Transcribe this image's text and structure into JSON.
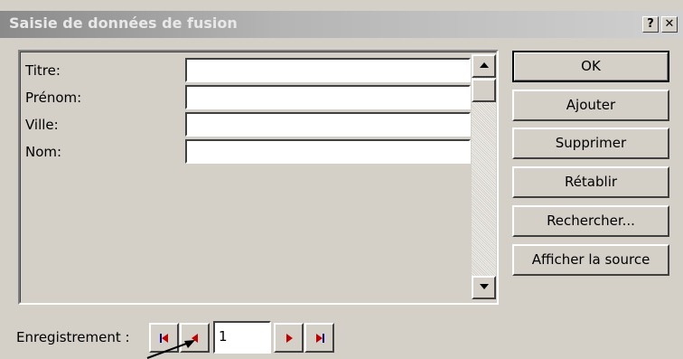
{
  "window": {
    "title": "Saisie de données de fusion",
    "help_label": "?",
    "close_label": "✕"
  },
  "fields": [
    {
      "label": "Titre:",
      "value": ""
    },
    {
      "label": "Prénom:",
      "value": ""
    },
    {
      "label": "Ville:",
      "value": ""
    },
    {
      "label": "Nom:",
      "value": ""
    }
  ],
  "buttons": {
    "ok": "OK",
    "ajouter": "Ajouter",
    "supprimer": "Supprimer",
    "retablir": "Rétablir",
    "rechercher": "Rechercher...",
    "afficher": "Afficher la source"
  },
  "navigation": {
    "label": "Enregistrement :",
    "record": "1"
  },
  "colors": {
    "nav_arrow": "#c00000",
    "nav_bar": "#000080"
  }
}
